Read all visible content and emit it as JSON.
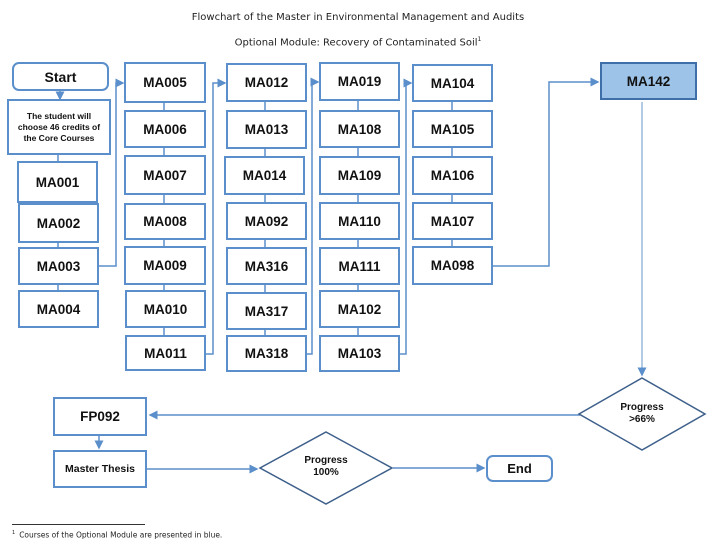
{
  "title": "Flowchart of the Master in Environmental Management and Audits",
  "subtitle": "Optional Module: Recovery of Contaminated Soil",
  "subtitle_footnote_mark": "1",
  "start": "Start",
  "intro": "The student will choose 46 credits of the Core Courses",
  "columns": [
    [
      "MA001",
      "MA002",
      "MA003",
      "MA004"
    ],
    [
      "MA005",
      "MA006",
      "MA007",
      "MA008",
      "MA009",
      "MA010",
      "MA011"
    ],
    [
      "MA012",
      "MA013",
      "MA014",
      "MA092",
      "MA316",
      "MA317",
      "MA318"
    ],
    [
      "MA019",
      "MA108",
      "MA109",
      "MA110",
      "MA111",
      "MA102",
      "MA103"
    ],
    [
      "MA104",
      "MA105",
      "MA106",
      "MA107",
      "MA098"
    ]
  ],
  "optional_course": "MA142",
  "decision_1": {
    "line1": "Progress",
    "line2": ">66%"
  },
  "fp": "FP092",
  "thesis": "Master Thesis",
  "decision_2": {
    "line1": "Progress",
    "line2": "100%"
  },
  "end": "End",
  "footnote": {
    "mark": "1",
    "text": "Courses of the Optional Module are presented in blue."
  },
  "colors": {
    "border": "#5b8fcb",
    "optional_fill": "#9dc3e8",
    "line": "#5b8fcb",
    "diamond": "#3d5f8a"
  }
}
